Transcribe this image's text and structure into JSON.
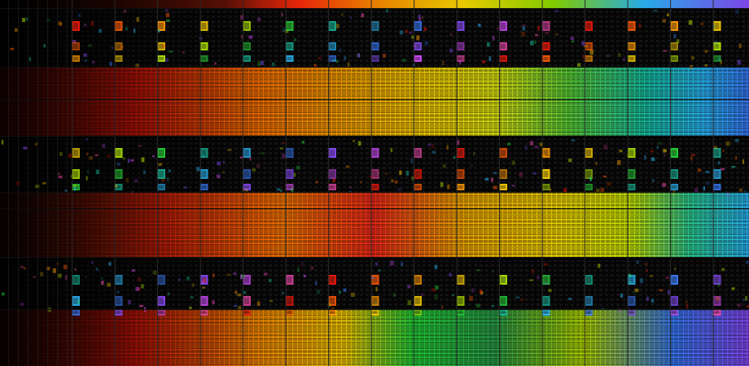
{
  "image": {
    "subject": "macro-photo-of-silicon-wafer-die-pattern",
    "palette": [
      "#ff1a0a",
      "#ff5a00",
      "#ff9a00",
      "#ffd200",
      "#b8f000",
      "#27d83a",
      "#19c9a8",
      "#2bbcff",
      "#3a7dff",
      "#8a4dff",
      "#d34dff",
      "#ff4db8"
    ],
    "background_color": "#020202",
    "grid_line_color": "#2a2a2a",
    "band_count": 3
  }
}
